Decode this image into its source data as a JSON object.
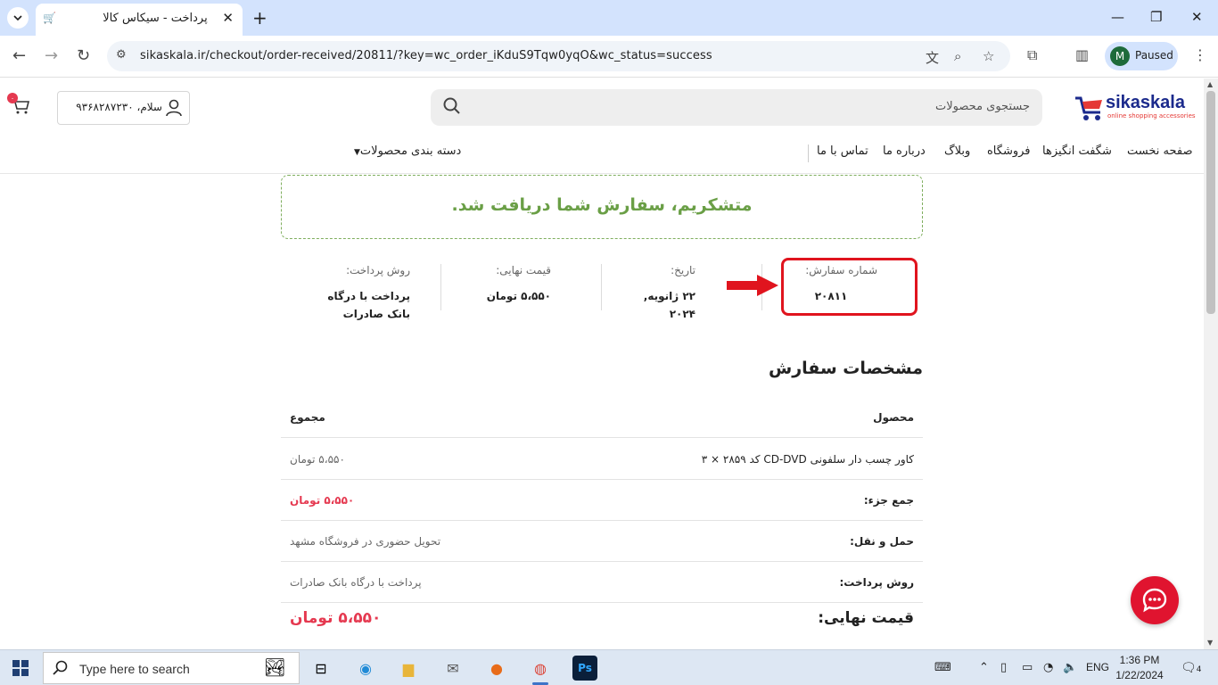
{
  "browser": {
    "tab_title": "پرداخت - سیکاس کالا",
    "url": "sikaskala.ir/checkout/order-received/20811/?key=wc_order_iKduS9Tqw0yqO&wc_status=success",
    "profile_initial": "M",
    "profile_status": "Paused"
  },
  "site": {
    "brand": "sikaskala",
    "tagline": "online shopping accessories",
    "search_placeholder": "جستجوی محصولات",
    "account_text": "سلام، ۹۳۶۸۲۸۷۲۳۰",
    "cart_count": "۰",
    "nav": {
      "home": "صفحه نخست",
      "gadgets": "شگفت انگیزها",
      "shop": "فروشگاه",
      "blog": "وبلاگ",
      "about": "درباره ما",
      "contact": "تماس با ما",
      "categories": "دسته بندی محصولات"
    }
  },
  "order": {
    "thank_you": "متشکریم، سفارش شما دریافت شد.",
    "overview": {
      "order_number_label": "شماره سفارش:",
      "order_number": "۲۰۸۱۱",
      "date_label": "تاریخ:",
      "date": "۲۲ ژانویه, ۲۰۲۴",
      "total_label": "قیمت نهایی:",
      "total": "۵،۵۵۰ تومان",
      "payment_label": "روش پرداخت:",
      "payment": "پرداخت با درگاه بانک صادرات"
    },
    "details_title": "مشخصات سفارش",
    "table": {
      "col_product": "محصول",
      "col_total": "مجموع",
      "item_name": "کاور چسب دار سلفونی CD-DVD کد ۲۸۵۹ × ۳",
      "item_total": "۵،۵۵۰ تومان",
      "subtotal_label": "جمع جزء:",
      "subtotal": "۵،۵۵۰ تومان",
      "shipping_label": "حمل و نقل:",
      "shipping": "تحویل حضوری در فروشگاه مشهد",
      "payment_label": "روش پرداخت:",
      "payment": "پرداخت با درگاه بانک صادرات",
      "final_label": "قیمت نهایی:",
      "final": "۵،۵۵۰ تومان"
    }
  },
  "taskbar": {
    "search_text": "Type here to search",
    "lang": "ENG",
    "time": "1:36 PM",
    "date": "1/22/2024",
    "notifications": "4"
  },
  "colors": {
    "accent_red": "#e0141e",
    "success_green": "#6a9f46",
    "brand_blue": "#1b2a8c"
  }
}
